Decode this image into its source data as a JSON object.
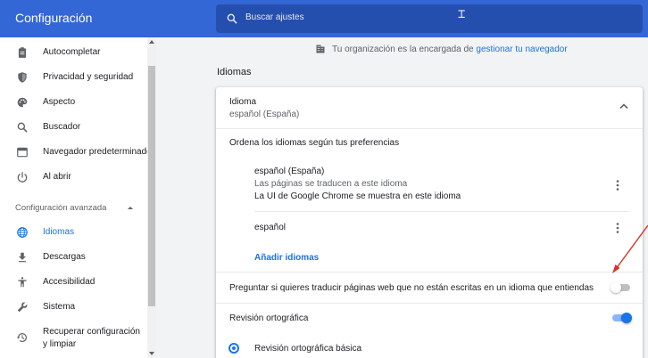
{
  "header": {
    "title": "Configuración",
    "search": {
      "placeholder": "Buscar ajustes",
      "icon": "search-icon"
    }
  },
  "sidebar": {
    "items": [
      {
        "label": "Autocompletar",
        "icon": "clipboard-icon"
      },
      {
        "label": "Privacidad y seguridad",
        "icon": "shield-icon"
      },
      {
        "label": "Aspecto",
        "icon": "palette-icon"
      },
      {
        "label": "Buscador",
        "icon": "search-icon"
      },
      {
        "label": "Navegador predeterminado",
        "icon": "browser-window-icon"
      },
      {
        "label": "Al abrir",
        "icon": "power-icon"
      }
    ],
    "advanced_heading": "Configuración avanzada",
    "advanced_items": [
      {
        "label": "Idiomas",
        "icon": "globe-icon",
        "active": true
      },
      {
        "label": "Descargas",
        "icon": "download-icon"
      },
      {
        "label": "Accesibilidad",
        "icon": "accessibility-icon"
      },
      {
        "label": "Sistema",
        "icon": "wrench-icon"
      },
      {
        "label": "Recuperar configuración y limpiar",
        "icon": "restore-icon"
      }
    ]
  },
  "main": {
    "org_notice": {
      "prefix": "Tu organización es la encargada de ",
      "link": "gestionar tu navegador"
    },
    "section_title": "Idiomas",
    "card": {
      "language_title": "Idioma",
      "language_value": "español (España)",
      "order_label": "Ordena los idiomas según tus preferencias",
      "languages": [
        {
          "name": "español (España)",
          "note_translate": "Las páginas se traducen a este idioma",
          "note_ui": "La UI de Google Chrome se muestra en este idioma"
        },
        {
          "name": "español"
        }
      ],
      "add_languages": "Añadir idiomas",
      "translate_offer_label": "Preguntar si quieres traducir páginas web que no están escritas en un idioma que entiendas",
      "translate_offer_enabled": false,
      "spellcheck_label": "Revisión ortográfica",
      "spellcheck_enabled": true,
      "spellcheck_basic_label": "Revisión ortográfica básica"
    }
  },
  "colors": {
    "header_bg": "#3367d6",
    "accent": "#1a73e8",
    "annotation_arrow": "#d93025"
  }
}
